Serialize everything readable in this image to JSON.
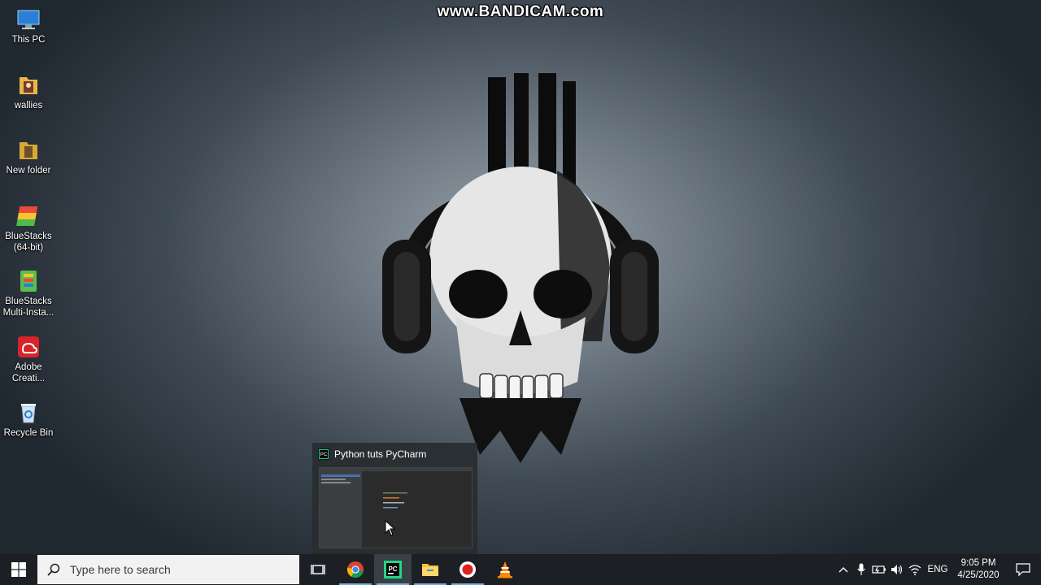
{
  "watermark": "www.BANDICAM.com",
  "desktop": {
    "icons": [
      {
        "label": "This PC"
      },
      {
        "label": "wallies"
      },
      {
        "label": "New folder"
      },
      {
        "label": "BlueStacks\n(64-bit)"
      },
      {
        "label": "BlueStacks\nMulti-Insta..."
      },
      {
        "label": "Adobe\nCreati..."
      },
      {
        "label": "Recycle Bin"
      }
    ]
  },
  "preview": {
    "title": "Python tuts PyCharm",
    "app_badge": "PC"
  },
  "taskbar": {
    "search_placeholder": "Type here to search",
    "pinned": [
      "task-view",
      "chrome",
      "pycharm",
      "file-explorer",
      "bandicam",
      "vlc"
    ],
    "active": "pycharm"
  },
  "tray": {
    "language": "ENG",
    "time": "9:05 PM",
    "date": "4/25/2020"
  },
  "colors": {
    "taskbar": "#1c1f24",
    "active_underline": "#7aa7d9",
    "search_bg": "#f2f2f2"
  }
}
